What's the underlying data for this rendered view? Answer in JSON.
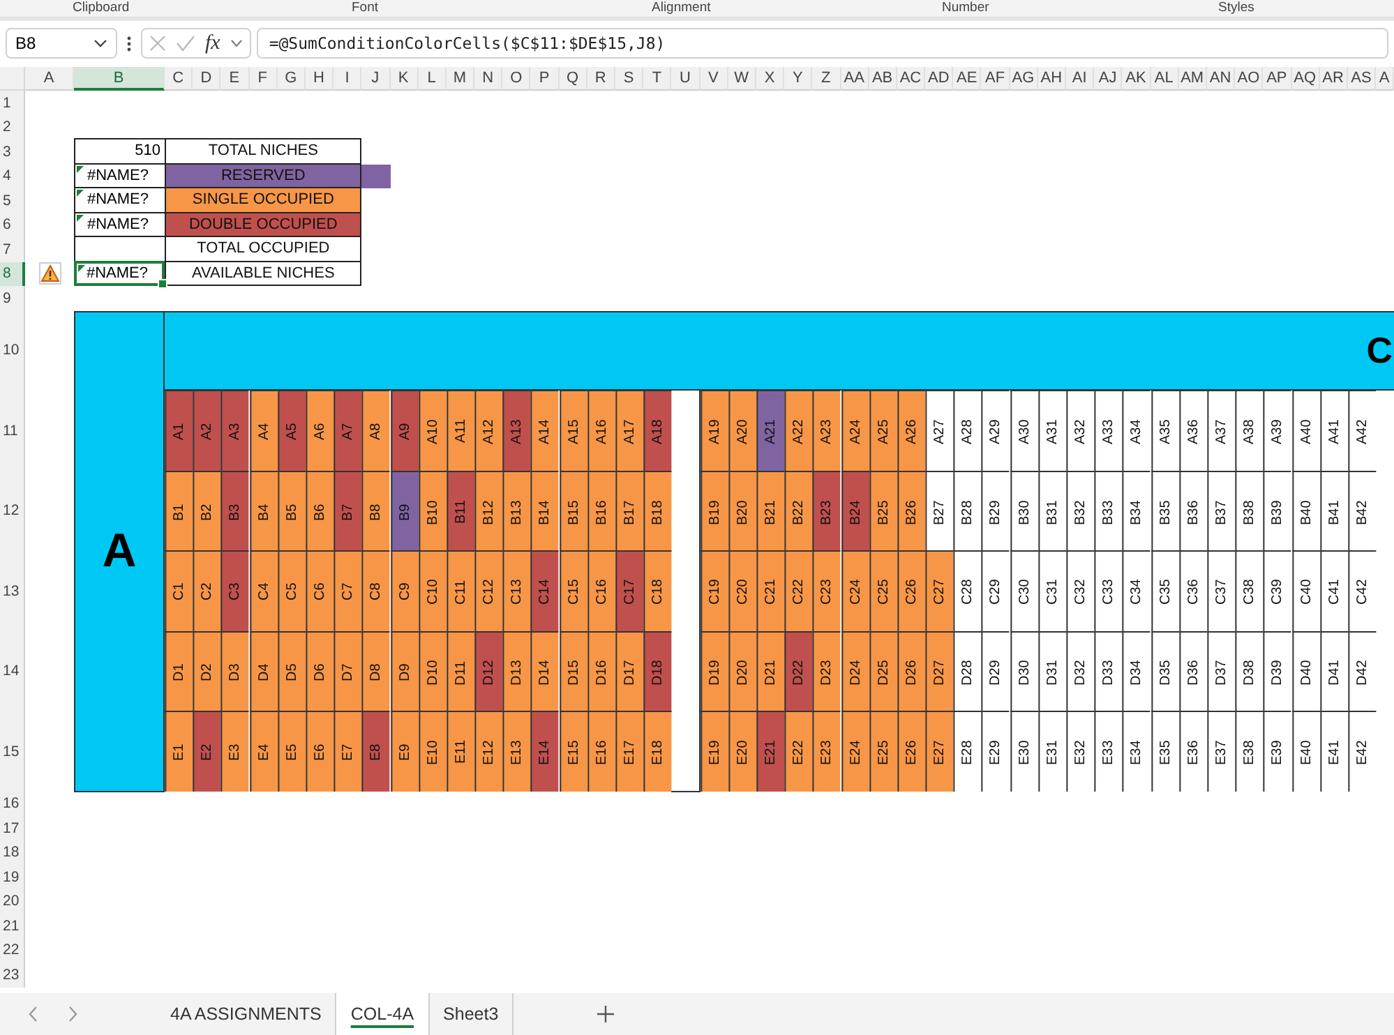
{
  "ribbon_groups": [
    "Clipboard",
    "Font",
    "Alignment",
    "Number",
    "Styles"
  ],
  "formula_bar": {
    "name_box": "B8",
    "function_label": "fx",
    "formula": "=@SumConditionColorCells($C$11:$DE$15,J8)"
  },
  "column_headers": [
    {
      "label": "A",
      "selected": false
    },
    {
      "label": "B",
      "selected": true
    },
    {
      "label": "C",
      "selected": false
    },
    {
      "label": "D",
      "selected": false
    },
    {
      "label": "E",
      "selected": false
    },
    {
      "label": "F",
      "selected": false
    },
    {
      "label": "G",
      "selected": false
    },
    {
      "label": "H",
      "selected": false
    },
    {
      "label": "I",
      "selected": false
    },
    {
      "label": "J",
      "selected": false
    },
    {
      "label": "K",
      "selected": false
    },
    {
      "label": "L",
      "selected": false
    },
    {
      "label": "M",
      "selected": false
    },
    {
      "label": "N",
      "selected": false
    },
    {
      "label": "O",
      "selected": false
    },
    {
      "label": "P",
      "selected": false
    },
    {
      "label": "Q",
      "selected": false
    },
    {
      "label": "R",
      "selected": false
    },
    {
      "label": "S",
      "selected": false
    },
    {
      "label": "T",
      "selected": false
    },
    {
      "label": "U",
      "selected": false
    },
    {
      "label": "V",
      "selected": false
    },
    {
      "label": "W",
      "selected": false
    },
    {
      "label": "X",
      "selected": false
    },
    {
      "label": "Y",
      "selected": false
    },
    {
      "label": "Z",
      "selected": false
    },
    {
      "label": "AA",
      "selected": false
    },
    {
      "label": "AB",
      "selected": false
    },
    {
      "label": "AC",
      "selected": false
    },
    {
      "label": "AD",
      "selected": false
    },
    {
      "label": "AE",
      "selected": false
    },
    {
      "label": "AF",
      "selected": false
    },
    {
      "label": "AG",
      "selected": false
    },
    {
      "label": "AH",
      "selected": false
    },
    {
      "label": "AI",
      "selected": false
    },
    {
      "label": "AJ",
      "selected": false
    },
    {
      "label": "AK",
      "selected": false
    },
    {
      "label": "AL",
      "selected": false
    },
    {
      "label": "AM",
      "selected": false
    },
    {
      "label": "AN",
      "selected": false
    },
    {
      "label": "AO",
      "selected": false
    },
    {
      "label": "AP",
      "selected": false
    },
    {
      "label": "AQ",
      "selected": false
    },
    {
      "label": "AR",
      "selected": false
    },
    {
      "label": "AS",
      "selected": false
    },
    {
      "label": "A",
      "selected": false
    }
  ],
  "row_headers": [
    {
      "label": "1",
      "selected": false
    },
    {
      "label": "2",
      "selected": false
    },
    {
      "label": "3",
      "selected": false
    },
    {
      "label": "4",
      "selected": false
    },
    {
      "label": "5",
      "selected": false
    },
    {
      "label": "6",
      "selected": false
    },
    {
      "label": "7",
      "selected": false
    },
    {
      "label": "8",
      "selected": true
    },
    {
      "label": "9",
      "selected": false
    },
    {
      "label": "10",
      "selected": false
    },
    {
      "label": "11",
      "selected": false
    },
    {
      "label": "12",
      "selected": false
    },
    {
      "label": "13",
      "selected": false
    },
    {
      "label": "14",
      "selected": false
    },
    {
      "label": "15",
      "selected": false
    },
    {
      "label": "16",
      "selected": false
    },
    {
      "label": "17",
      "selected": false
    },
    {
      "label": "18",
      "selected": false
    },
    {
      "label": "19",
      "selected": false
    },
    {
      "label": "20",
      "selected": false
    },
    {
      "label": "21",
      "selected": false
    },
    {
      "label": "22",
      "selected": false
    },
    {
      "label": "23",
      "selected": false
    }
  ],
  "summary": [
    {
      "value": "510",
      "kind": "number",
      "label": "TOTAL NICHES",
      "flagged": false,
      "spill": false,
      "active": false,
      "warning": false
    },
    {
      "value": "#NAME?",
      "kind": "error",
      "label": "RESERVED",
      "color": "#8064a2",
      "flagged": true,
      "spill": true,
      "active": false,
      "warning": false
    },
    {
      "value": "#NAME?",
      "kind": "error",
      "label": "SINGLE OCCUPIED",
      "color": "#f79646",
      "flagged": true,
      "spill": false,
      "active": false,
      "warning": false
    },
    {
      "value": "#NAME?",
      "kind": "error",
      "label": "DOUBLE OCCUPIED",
      "color": "#c0504d",
      "flagged": true,
      "spill": false,
      "active": false,
      "warning": false
    },
    {
      "kind": "empty",
      "label": "TOTAL OCCUPIED",
      "flagged": false,
      "spill": false,
      "active": false,
      "warning": false
    },
    {
      "value": "#NAME?",
      "kind": "error",
      "label": "AVAILABLE NICHES",
      "flagged": true,
      "spill": false,
      "active": true,
      "warning": true
    }
  ],
  "section": {
    "title": "A",
    "next_title": "C"
  },
  "niche_rows": [
    {
      "cells": [
        {
          "label": "A1",
          "color": "#c0504d"
        },
        {
          "label": "A2",
          "color": "#c0504d"
        },
        {
          "label": "A3",
          "color": "#c0504d"
        },
        {
          "label": "A4",
          "color": "#f79646"
        },
        {
          "label": "A5",
          "color": "#c0504d"
        },
        {
          "label": "A6",
          "color": "#f79646"
        },
        {
          "label": "A7",
          "color": "#c0504d"
        },
        {
          "label": "A8",
          "color": "#f79646"
        },
        {
          "label": "A9",
          "color": "#c0504d"
        },
        {
          "label": "A10",
          "color": "#f79646"
        },
        {
          "label": "A11",
          "color": "#f79646"
        },
        {
          "label": "A12",
          "color": "#f79646"
        },
        {
          "label": "A13",
          "color": "#c0504d"
        },
        {
          "label": "A14",
          "color": "#f79646"
        },
        {
          "label": "A15",
          "color": "#f79646"
        },
        {
          "label": "A16",
          "color": "#f79646"
        },
        {
          "label": "A17",
          "color": "#f79646"
        },
        {
          "label": "A18",
          "color": "#c0504d"
        },
        {
          "label": "A19",
          "color": "#f79646"
        },
        {
          "label": "A20",
          "color": "#f79646"
        },
        {
          "label": "A21",
          "color": "#8064a2"
        },
        {
          "label": "A22",
          "color": "#f79646"
        },
        {
          "label": "A23",
          "color": "#f79646"
        },
        {
          "label": "A24",
          "color": "#f79646"
        },
        {
          "label": "A25",
          "color": "#f79646"
        },
        {
          "label": "A26",
          "color": "#f79646"
        },
        {
          "label": "A27",
          "color": "#ffffff"
        },
        {
          "label": "A28",
          "color": "#ffffff"
        },
        {
          "label": "A29",
          "color": "#ffffff"
        },
        {
          "label": "A30",
          "color": "#ffffff"
        },
        {
          "label": "A31",
          "color": "#ffffff"
        },
        {
          "label": "A32",
          "color": "#ffffff"
        },
        {
          "label": "A33",
          "color": "#ffffff"
        },
        {
          "label": "A34",
          "color": "#ffffff"
        },
        {
          "label": "A35",
          "color": "#ffffff"
        },
        {
          "label": "A36",
          "color": "#ffffff"
        },
        {
          "label": "A37",
          "color": "#ffffff"
        },
        {
          "label": "A38",
          "color": "#ffffff"
        },
        {
          "label": "A39",
          "color": "#ffffff"
        },
        {
          "label": "A40",
          "color": "#ffffff"
        },
        {
          "label": "A41",
          "color": "#ffffff"
        },
        {
          "label": "A42",
          "color": "#ffffff"
        }
      ]
    },
    {
      "cells": [
        {
          "label": "B1",
          "color": "#f79646"
        },
        {
          "label": "B2",
          "color": "#f79646"
        },
        {
          "label": "B3",
          "color": "#c0504d"
        },
        {
          "label": "B4",
          "color": "#f79646"
        },
        {
          "label": "B5",
          "color": "#f79646"
        },
        {
          "label": "B6",
          "color": "#f79646"
        },
        {
          "label": "B7",
          "color": "#c0504d"
        },
        {
          "label": "B8",
          "color": "#f79646"
        },
        {
          "label": "B9",
          "color": "#8064a2"
        },
        {
          "label": "B10",
          "color": "#f79646"
        },
        {
          "label": "B11",
          "color": "#c0504d"
        },
        {
          "label": "B12",
          "color": "#f79646"
        },
        {
          "label": "B13",
          "color": "#f79646"
        },
        {
          "label": "B14",
          "color": "#f79646"
        },
        {
          "label": "B15",
          "color": "#f79646"
        },
        {
          "label": "B16",
          "color": "#f79646"
        },
        {
          "label": "B17",
          "color": "#f79646"
        },
        {
          "label": "B18",
          "color": "#f79646"
        },
        {
          "label": "B19",
          "color": "#f79646"
        },
        {
          "label": "B20",
          "color": "#f79646"
        },
        {
          "label": "B21",
          "color": "#f79646"
        },
        {
          "label": "B22",
          "color": "#f79646"
        },
        {
          "label": "B23",
          "color": "#c0504d"
        },
        {
          "label": "B24",
          "color": "#c0504d"
        },
        {
          "label": "B25",
          "color": "#f79646"
        },
        {
          "label": "B26",
          "color": "#f79646"
        },
        {
          "label": "B27",
          "color": "#ffffff"
        },
        {
          "label": "B28",
          "color": "#ffffff"
        },
        {
          "label": "B29",
          "color": "#ffffff"
        },
        {
          "label": "B30",
          "color": "#ffffff"
        },
        {
          "label": "B31",
          "color": "#ffffff"
        },
        {
          "label": "B32",
          "color": "#ffffff"
        },
        {
          "label": "B33",
          "color": "#ffffff"
        },
        {
          "label": "B34",
          "color": "#ffffff"
        },
        {
          "label": "B35",
          "color": "#ffffff"
        },
        {
          "label": "B36",
          "color": "#ffffff"
        },
        {
          "label": "B37",
          "color": "#ffffff"
        },
        {
          "label": "B38",
          "color": "#ffffff"
        },
        {
          "label": "B39",
          "color": "#ffffff"
        },
        {
          "label": "B40",
          "color": "#ffffff"
        },
        {
          "label": "B41",
          "color": "#ffffff"
        },
        {
          "label": "B42",
          "color": "#ffffff"
        }
      ]
    },
    {
      "cells": [
        {
          "label": "C1",
          "color": "#f79646"
        },
        {
          "label": "C2",
          "color": "#f79646"
        },
        {
          "label": "C3",
          "color": "#c0504d"
        },
        {
          "label": "C4",
          "color": "#f79646"
        },
        {
          "label": "C5",
          "color": "#f79646"
        },
        {
          "label": "C6",
          "color": "#f79646"
        },
        {
          "label": "C7",
          "color": "#f79646"
        },
        {
          "label": "C8",
          "color": "#f79646"
        },
        {
          "label": "C9",
          "color": "#f79646"
        },
        {
          "label": "C10",
          "color": "#f79646"
        },
        {
          "label": "C11",
          "color": "#f79646"
        },
        {
          "label": "C12",
          "color": "#f79646"
        },
        {
          "label": "C13",
          "color": "#f79646"
        },
        {
          "label": "C14",
          "color": "#c0504d"
        },
        {
          "label": "C15",
          "color": "#f79646"
        },
        {
          "label": "C16",
          "color": "#f79646"
        },
        {
          "label": "C17",
          "color": "#c0504d"
        },
        {
          "label": "C18",
          "color": "#f79646"
        },
        {
          "label": "C19",
          "color": "#f79646"
        },
        {
          "label": "C20",
          "color": "#f79646"
        },
        {
          "label": "C21",
          "color": "#f79646"
        },
        {
          "label": "C22",
          "color": "#f79646"
        },
        {
          "label": "C23",
          "color": "#f79646"
        },
        {
          "label": "C24",
          "color": "#f79646"
        },
        {
          "label": "C25",
          "color": "#f79646"
        },
        {
          "label": "C26",
          "color": "#f79646"
        },
        {
          "label": "C27",
          "color": "#f79646"
        },
        {
          "label": "C28",
          "color": "#ffffff"
        },
        {
          "label": "C29",
          "color": "#ffffff"
        },
        {
          "label": "C30",
          "color": "#ffffff"
        },
        {
          "label": "C31",
          "color": "#ffffff"
        },
        {
          "label": "C32",
          "color": "#ffffff"
        },
        {
          "label": "C33",
          "color": "#ffffff"
        },
        {
          "label": "C34",
          "color": "#ffffff"
        },
        {
          "label": "C35",
          "color": "#ffffff"
        },
        {
          "label": "C36",
          "color": "#ffffff"
        },
        {
          "label": "C37",
          "color": "#ffffff"
        },
        {
          "label": "C38",
          "color": "#ffffff"
        },
        {
          "label": "C39",
          "color": "#ffffff"
        },
        {
          "label": "C40",
          "color": "#ffffff"
        },
        {
          "label": "C41",
          "color": "#ffffff"
        },
        {
          "label": "C42",
          "color": "#ffffff"
        }
      ]
    },
    {
      "cells": [
        {
          "label": "D1",
          "color": "#f79646"
        },
        {
          "label": "D2",
          "color": "#f79646"
        },
        {
          "label": "D3",
          "color": "#f79646"
        },
        {
          "label": "D4",
          "color": "#f79646"
        },
        {
          "label": "D5",
          "color": "#f79646"
        },
        {
          "label": "D6",
          "color": "#f79646"
        },
        {
          "label": "D7",
          "color": "#f79646"
        },
        {
          "label": "D8",
          "color": "#f79646"
        },
        {
          "label": "D9",
          "color": "#f79646"
        },
        {
          "label": "D10",
          "color": "#f79646"
        },
        {
          "label": "D11",
          "color": "#f79646"
        },
        {
          "label": "D12",
          "color": "#c0504d"
        },
        {
          "label": "D13",
          "color": "#f79646"
        },
        {
          "label": "D14",
          "color": "#f79646"
        },
        {
          "label": "D15",
          "color": "#f79646"
        },
        {
          "label": "D16",
          "color": "#f79646"
        },
        {
          "label": "D17",
          "color": "#f79646"
        },
        {
          "label": "D18",
          "color": "#c0504d"
        },
        {
          "label": "D19",
          "color": "#f79646"
        },
        {
          "label": "D20",
          "color": "#f79646"
        },
        {
          "label": "D21",
          "color": "#f79646"
        },
        {
          "label": "D22",
          "color": "#c0504d"
        },
        {
          "label": "D23",
          "color": "#f79646"
        },
        {
          "label": "D24",
          "color": "#f79646"
        },
        {
          "label": "D25",
          "color": "#f79646"
        },
        {
          "label": "D26",
          "color": "#f79646"
        },
        {
          "label": "D27",
          "color": "#f79646"
        },
        {
          "label": "D28",
          "color": "#ffffff"
        },
        {
          "label": "D29",
          "color": "#ffffff"
        },
        {
          "label": "D30",
          "color": "#ffffff"
        },
        {
          "label": "D31",
          "color": "#ffffff"
        },
        {
          "label": "D32",
          "color": "#ffffff"
        },
        {
          "label": "D33",
          "color": "#ffffff"
        },
        {
          "label": "D34",
          "color": "#ffffff"
        },
        {
          "label": "D35",
          "color": "#ffffff"
        },
        {
          "label": "D36",
          "color": "#ffffff"
        },
        {
          "label": "D37",
          "color": "#ffffff"
        },
        {
          "label": "D38",
          "color": "#ffffff"
        },
        {
          "label": "D39",
          "color": "#ffffff"
        },
        {
          "label": "D40",
          "color": "#ffffff"
        },
        {
          "label": "D41",
          "color": "#ffffff"
        },
        {
          "label": "D42",
          "color": "#ffffff"
        }
      ]
    },
    {
      "cells": [
        {
          "label": "E1",
          "color": "#f79646"
        },
        {
          "label": "E2",
          "color": "#c0504d"
        },
        {
          "label": "E3",
          "color": "#f79646"
        },
        {
          "label": "E4",
          "color": "#f79646"
        },
        {
          "label": "E5",
          "color": "#f79646"
        },
        {
          "label": "E6",
          "color": "#f79646"
        },
        {
          "label": "E7",
          "color": "#f79646"
        },
        {
          "label": "E8",
          "color": "#c0504d"
        },
        {
          "label": "E9",
          "color": "#f79646"
        },
        {
          "label": "E10",
          "color": "#f79646"
        },
        {
          "label": "E11",
          "color": "#f79646"
        },
        {
          "label": "E12",
          "color": "#f79646"
        },
        {
          "label": "E13",
          "color": "#f79646"
        },
        {
          "label": "E14",
          "color": "#c0504d"
        },
        {
          "label": "E15",
          "color": "#f79646"
        },
        {
          "label": "E16",
          "color": "#f79646"
        },
        {
          "label": "E17",
          "color": "#f79646"
        },
        {
          "label": "E18",
          "color": "#f79646"
        },
        {
          "label": "E19",
          "color": "#f79646"
        },
        {
          "label": "E20",
          "color": "#f79646"
        },
        {
          "label": "E21",
          "color": "#c0504d"
        },
        {
          "label": "E22",
          "color": "#f79646"
        },
        {
          "label": "E23",
          "color": "#f79646"
        },
        {
          "label": "E24",
          "color": "#f79646"
        },
        {
          "label": "E25",
          "color": "#f79646"
        },
        {
          "label": "E26",
          "color": "#f79646"
        },
        {
          "label": "E27",
          "color": "#f79646"
        },
        {
          "label": "E28",
          "color": "#ffffff"
        },
        {
          "label": "E29",
          "color": "#ffffff"
        },
        {
          "label": "E30",
          "color": "#ffffff"
        },
        {
          "label": "E31",
          "color": "#ffffff"
        },
        {
          "label": "E32",
          "color": "#ffffff"
        },
        {
          "label": "E33",
          "color": "#ffffff"
        },
        {
          "label": "E34",
          "color": "#ffffff"
        },
        {
          "label": "E35",
          "color": "#ffffff"
        },
        {
          "label": "E36",
          "color": "#ffffff"
        },
        {
          "label": "E37",
          "color": "#ffffff"
        },
        {
          "label": "E38",
          "color": "#ffffff"
        },
        {
          "label": "E39",
          "color": "#ffffff"
        },
        {
          "label": "E40",
          "color": "#ffffff"
        },
        {
          "label": "E41",
          "color": "#ffffff"
        },
        {
          "label": "E42",
          "color": "#ffffff"
        }
      ]
    }
  ],
  "sheet_tabs": [
    {
      "label": "4A ASSIGNMENTS",
      "selected": false
    },
    {
      "label": "COL-4A",
      "selected": true
    },
    {
      "label": "Sheet3",
      "selected": false
    }
  ]
}
